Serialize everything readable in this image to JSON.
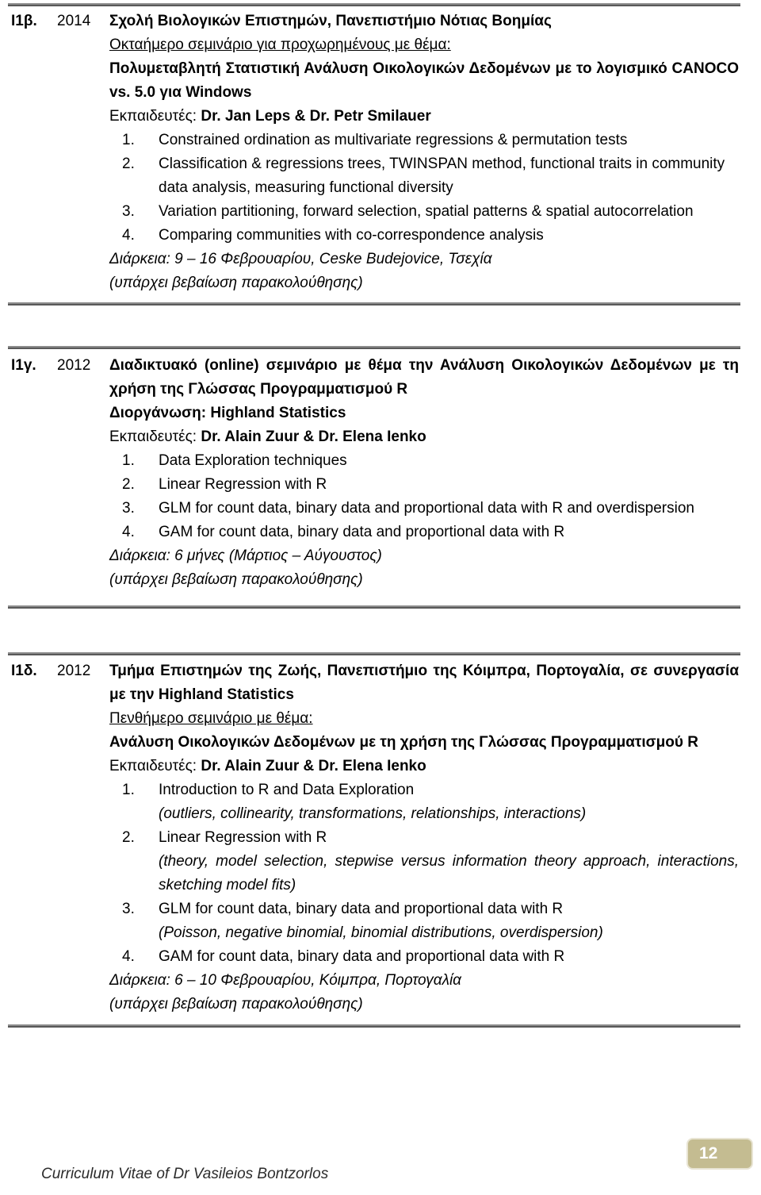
{
  "document": {
    "footer_text": "Curriculum Vitae of Dr Vasileios Bontzorlos",
    "page_number": "12",
    "badge_color": "#c4bc91",
    "rule_color": "#595959"
  },
  "entries": [
    {
      "code": "I1β.",
      "year": "2014",
      "title": "Σχολή Βιολογικών Επιστημών, Πανεπιστήμιο Νότιας Βοημίας",
      "subtitle_underlined": "Οκταήμερο σεμινάριο για προχωρημένους με θέμα:",
      "topic": "Πολυμεταβλητή Στατιστική Ανάλυση Οικολογικών Δεδομένων με το λογισμικό CANOCO vs. 5.0 για Windows",
      "instructors_label": "Εκπαιδευτές:",
      "instructors_names": "Dr. Jan Leps & Dr. Petr Smilauer",
      "items": [
        {
          "text": "Constrained ordination as multivariate regressions & permutation tests",
          "sub": ""
        },
        {
          "text": "Classification & regressions trees, TWINSPAN method, functional traits in community data analysis, measuring functional diversity",
          "sub": ""
        },
        {
          "text": "Variation partitioning, forward selection, spatial patterns & spatial autocorrelation",
          "sub": ""
        },
        {
          "text": "Comparing communities with co-correspondence analysis",
          "sub": ""
        }
      ],
      "duration": "Διάρκεια: 9 – 16 Φεβρουαρίου, Ceske Budejovice, Τσεχία",
      "certificate": "(υπάρχει βεβαίωση παρακολούθησης)"
    },
    {
      "code": "I1γ.",
      "year": "2012",
      "title": "Διαδικτυακό (online) σεμινάριο με θέμα την Ανάλυση Οικολογικών Δεδομένων με τη χρήση της Γλώσσας Προγραμματισμού R",
      "organizer": "Διοργάνωση: Highland Statistics",
      "instructors_label": "Εκπαιδευτές:",
      "instructors_names": "Dr. Alain Zuur & Dr. Elena Ienko",
      "items": [
        {
          "text": "Data Exploration techniques",
          "sub": ""
        },
        {
          "text": "Linear Regression with R",
          "sub": ""
        },
        {
          "text": "GLM for count data, binary data and proportional data with R and overdispersion",
          "sub": ""
        },
        {
          "text": "GAM for count data, binary data and proportional data with R",
          "sub": ""
        }
      ],
      "duration": "Διάρκεια: 6 μήνες (Μάρτιος – Αύγουστος)",
      "certificate": "(υπάρχει βεβαίωση παρακολούθησης)"
    },
    {
      "code": "I1δ.",
      "year": "2012",
      "title": "Τμήμα Επιστημών της Ζωής, Πανεπιστήμιο της Κόιμπρα, Πορτογαλία, σε συνεργασία με την Highland Statistics",
      "subtitle_underlined": "Πενθήμερο σεμινάριο με θέμα:",
      "topic": "Ανάλυση Οικολογικών Δεδομένων με τη χρήση της Γλώσσας Προγραμματισμού R",
      "instructors_label": "Εκπαιδευτές:",
      "instructors_names": "Dr. Alain Zuur & Dr. Elena Ienko",
      "items": [
        {
          "text": "Introduction to R and Data Exploration",
          "sub": "(outliers, collinearity, transformations, relationships, interactions)"
        },
        {
          "text": "Linear Regression with R",
          "sub": "(theory, model selection, stepwise versus information theory approach, interactions, sketching model fits)"
        },
        {
          "text": "GLM for count data, binary data and proportional data with R",
          "sub": "(Poisson, negative binomial, binomial distributions, overdispersion)"
        },
        {
          "text": "GAM for count data, binary data and proportional data with R",
          "sub": ""
        }
      ],
      "duration": "Διάρκεια: 6 – 10 Φεβρουαρίου, Κόιμπρα, Πορτογαλία",
      "certificate": "(υπάρχει βεβαίωση παρακολούθησης)"
    }
  ]
}
